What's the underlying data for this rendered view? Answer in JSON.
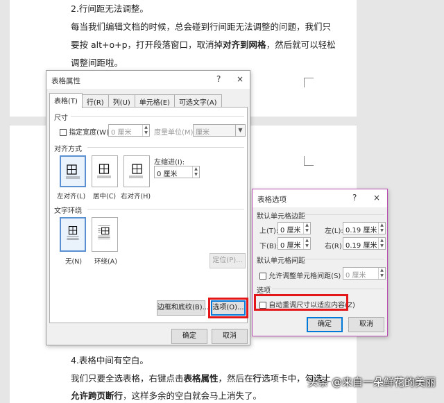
{
  "document": {
    "heading2": "2.行间距无法调整。",
    "para2_line1": "每当我们编辑文档的时候，总会碰到行间距无法调整的问题，我们只",
    "para2_line2_pre": "要按 alt+o+p，打开段落窗口，取消掉",
    "para2_line2_bold": "对齐到网格",
    "para2_line2_post": "，然后就可以轻松",
    "para2_line3": "调整间距啦。",
    "heading4": "4.表格中间有空白。",
    "para4_line1_pre": "我们只要全选表格，右键点击",
    "para4_line1_bold1": "表格属性",
    "para4_line1_mid": "，然后在",
    "para4_line1_bold2": "行",
    "para4_line1_post": "选项卡中，勾选上",
    "para4_line2_bold": "允许跨页断行",
    "para4_line2_post": "，这样多余的空白就会马上消失了。",
    "watermark": "头条 @来自一朵鲜花的美丽"
  },
  "table_props": {
    "title": "表格属性",
    "help": "?",
    "close": "×",
    "tabs": [
      "表格(T)",
      "行(R)",
      "列(U)",
      "单元格(E)",
      "可选文字(A)"
    ],
    "size_label": "尺寸",
    "specify_width": "指定宽度(W):",
    "width_value": "0 厘米",
    "measure_label": "度量单位(M):",
    "measure_value": "厘米",
    "align_label": "对齐方式",
    "align_left": "左对齐(L)",
    "align_center": "居中(C)",
    "align_right": "右对齐(H)",
    "indent_label": "左缩进(I):",
    "indent_value": "0 厘米",
    "wrap_label": "文字环绕",
    "wrap_none": "无(N)",
    "wrap_around": "环绕(A)",
    "position_btn": "定位(P)...",
    "borders_btn": "边框和底纹(B)...",
    "options_btn": "选项(O)...",
    "ok": "确定",
    "cancel": "取消"
  },
  "table_options": {
    "title": "表格选项",
    "help": "?",
    "close": "×",
    "margins_label": "默认单元格边距",
    "top_label": "上(T):",
    "top_value": "0 厘米",
    "left_label": "左(L):",
    "left_value": "0.19 厘米",
    "bottom_label": "下(B):",
    "bottom_value": "0 厘米",
    "right_label": "右(R):",
    "right_value": "0.19 厘米",
    "spacing_label": "默认单元格间距",
    "allow_spacing": "允许调整单元格间距(S)",
    "spacing_value": "0 厘米",
    "options_label": "选项",
    "autoresize": "自动重调尺寸以适应内容(Z)",
    "ok": "确定",
    "cancel": "取消"
  },
  "colors": {
    "highlight": "#e3171a",
    "selected_tile": "#5a8fd1",
    "options_border": "#b94bb2"
  }
}
